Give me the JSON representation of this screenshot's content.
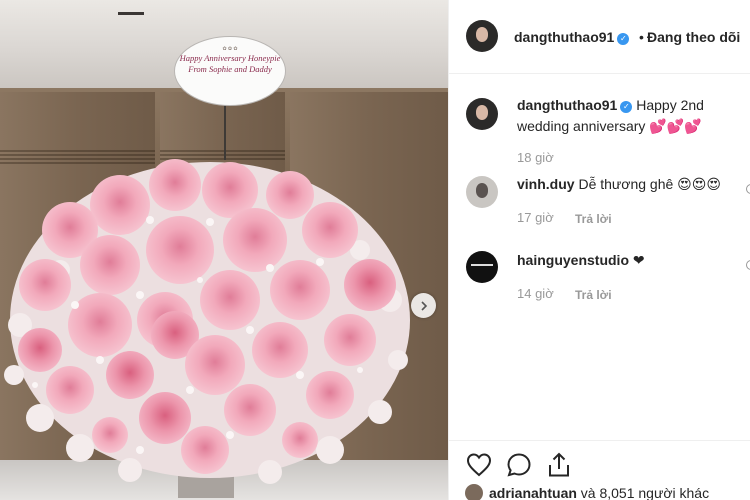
{
  "post": {
    "author": "dangthuthao91",
    "follow_status": "Đang theo dõi",
    "card_text": {
      "line1": "Happy Anniversary Honeypie",
      "line2": "From Sophie and Daddy"
    }
  },
  "comments": [
    {
      "username": "dangthuthao91",
      "text": "Happy 2nd wedding anniversary 💕💕💕",
      "time": "18 giờ"
    },
    {
      "username": "vinh.duy",
      "text": "Dễ thương ghê 😍😍😍",
      "time": "17 giờ",
      "reply_label": "Trả lời"
    },
    {
      "username": "hainguyenstudio",
      "text": "❤",
      "time": "14 giờ",
      "reply_label": "Trả lời"
    }
  ],
  "likes": {
    "first_user": "adrianahtuan",
    "others_text": "và 8,051 người khác"
  },
  "icons": {
    "like": "heart-icon",
    "comment": "comment-icon",
    "share": "share-icon",
    "next": "chevron-right-icon",
    "verified": "verified-badge-icon"
  },
  "colors": {
    "verified": "#3897f0",
    "meta_text": "#999999",
    "text": "#262626"
  }
}
